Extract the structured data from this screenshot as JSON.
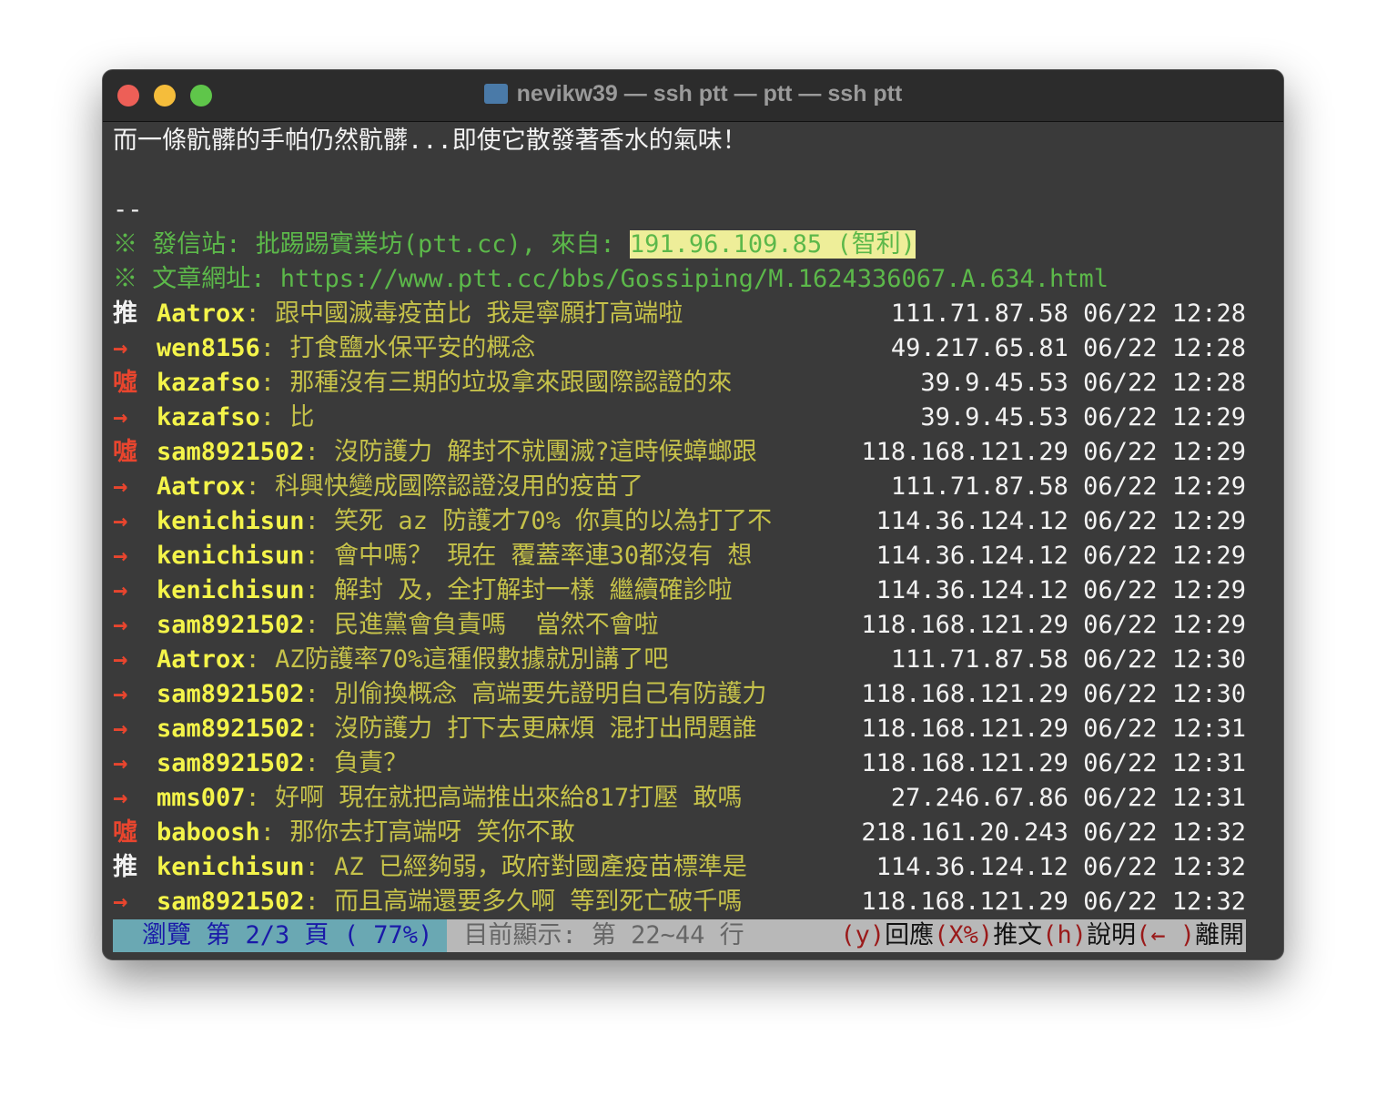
{
  "window": {
    "title": "nevikw39 — ssh ptt — ptt — ssh ptt"
  },
  "body": {
    "line1": "而一條骯髒的手帕仍然骯髒...即使它散發著香水的氣味！",
    "sep": "--",
    "source_prefix": "※ 發信站: 批踢踢實業坊(ptt.cc), 來自: ",
    "source_ip": "191.96.109.85 (智利)",
    "url_line": "※ 文章網址: https://www.ptt.cc/bbs/Gossiping/M.1624336067.A.634.html"
  },
  "comments": [
    {
      "tag": "推",
      "user": "Aatrox",
      "text": "跟中國滅毒疫苗比 我是寧願打高端啦",
      "ip": "111.71.87.58 06/22 12:28"
    },
    {
      "tag": "→",
      "user": "wen8156",
      "text": "打食鹽水保平安的概念",
      "ip": "49.217.65.81 06/22 12:28"
    },
    {
      "tag": "噓",
      "user": "kazafso",
      "text": "那種沒有三期的垃圾拿來跟國際認證的來",
      "ip": "39.9.45.53 06/22 12:28"
    },
    {
      "tag": "→",
      "user": "kazafso",
      "text": "比",
      "ip": "39.9.45.53 06/22 12:29"
    },
    {
      "tag": "噓",
      "user": "sam8921502",
      "text": "沒防護力 解封不就團滅?這時候蟑螂跟",
      "ip": "118.168.121.29 06/22 12:29"
    },
    {
      "tag": "→",
      "user": "Aatrox",
      "text": "科興快變成國際認證沒用的疫苗了",
      "ip": "111.71.87.58 06/22 12:29"
    },
    {
      "tag": "→",
      "user": "kenichisun",
      "text": "笑死 az 防護才70% 你真的以為打了不",
      "ip": "114.36.124.12 06/22 12:29"
    },
    {
      "tag": "→",
      "user": "kenichisun",
      "text": "會中嗎？ 現在 覆蓋率連30都沒有 想",
      "ip": "114.36.124.12 06/22 12:29"
    },
    {
      "tag": "→",
      "user": "kenichisun",
      "text": "解封 及，全打解封一樣 繼續確診啦",
      "ip": "114.36.124.12 06/22 12:29"
    },
    {
      "tag": "→",
      "user": "sam8921502",
      "text": "民進黨會負責嗎  當然不會啦",
      "ip": "118.168.121.29 06/22 12:29"
    },
    {
      "tag": "→",
      "user": "Aatrox",
      "text": "AZ防護率70%這種假數據就別講了吧",
      "ip": "111.71.87.58 06/22 12:30"
    },
    {
      "tag": "→",
      "user": "sam8921502",
      "text": "別偷換概念 高端要先證明自己有防護力",
      "ip": "118.168.121.29 06/22 12:30"
    },
    {
      "tag": "→",
      "user": "sam8921502",
      "text": "沒防護力 打下去更麻煩 混打出問題誰",
      "ip": "118.168.121.29 06/22 12:31"
    },
    {
      "tag": "→",
      "user": "sam8921502",
      "text": "負責？",
      "ip": "118.168.121.29 06/22 12:31"
    },
    {
      "tag": "→",
      "user": "mms007",
      "text": "好啊 現在就把高端推出來給817打壓 敢嗎",
      "ip": "27.246.67.86 06/22 12:31"
    },
    {
      "tag": "噓",
      "user": "baboosh",
      "text": "那你去打高端呀 笑你不敢",
      "ip": "218.161.20.243 06/22 12:32"
    },
    {
      "tag": "推",
      "user": "kenichisun",
      "text": "AZ 已經夠弱，政府對國產疫苗標準是",
      "ip": "114.36.124.12 06/22 12:32"
    },
    {
      "tag": "→",
      "user": "sam8921502",
      "text": "而且高端還要多久啊 等到死亡破千嗎",
      "ip": "118.168.121.29 06/22 12:32"
    }
  ],
  "status": {
    "page": "瀏覽 第 2/3 頁 ( 77%)",
    "lines": "目前顯示: 第 22~44 行",
    "k1": "(y)",
    "a1": "回應",
    "k2": "(X%)",
    "a2": "推文",
    "k3": "(h)",
    "a3": "說明",
    "k4": "(← )",
    "a4": "離開"
  },
  "colors": {
    "push": "#f2f2f2",
    "arrow": "#e8452e",
    "boo": "#e8452e"
  }
}
